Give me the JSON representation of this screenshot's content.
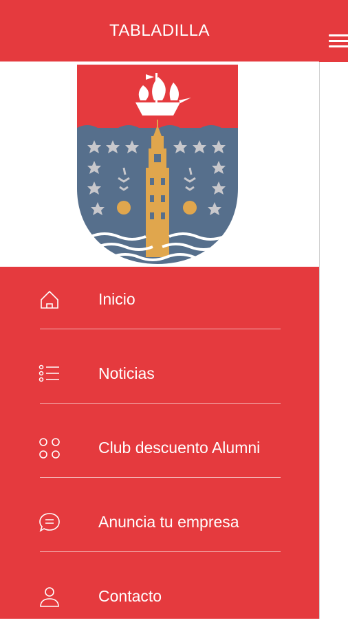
{
  "app": {
    "title": "TABLADILLA"
  },
  "colors": {
    "brand_red": "#e53a3e",
    "crest_blue": "#566f8c",
    "tower_gold": "#e0a64d",
    "star_gray": "#c8c8cc"
  },
  "menu": {
    "items": [
      {
        "label": "Inicio",
        "icon": "home-icon"
      },
      {
        "label": "Noticias",
        "icon": "list-icon"
      },
      {
        "label": "Club descuento Alumni",
        "icon": "grid-dots-icon"
      },
      {
        "label": "Anuncia tu empresa",
        "icon": "chat-bubble-icon"
      },
      {
        "label": "Contacto",
        "icon": "user-icon"
      }
    ]
  }
}
